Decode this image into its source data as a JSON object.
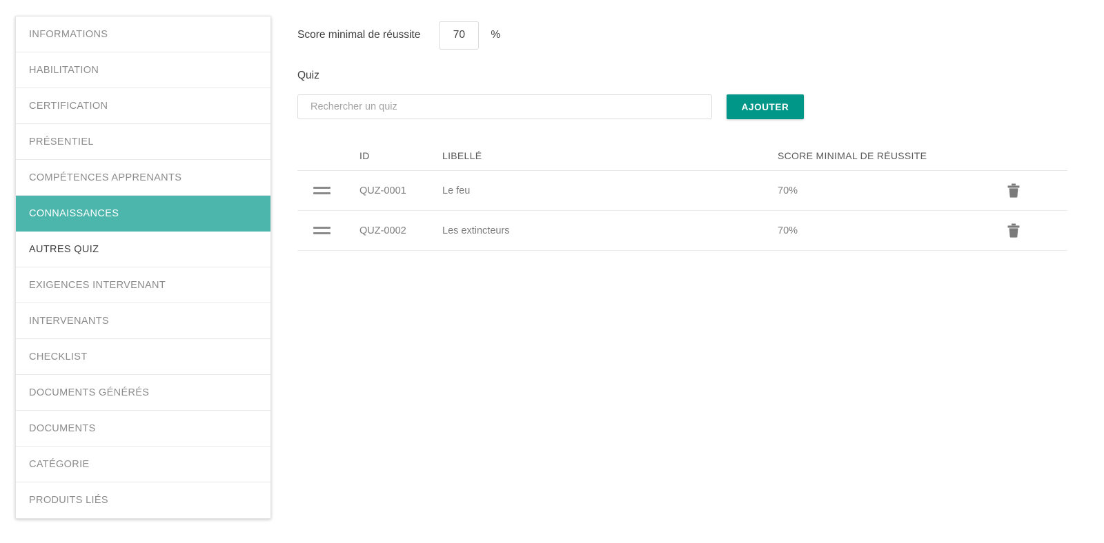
{
  "sidebar": {
    "items": [
      {
        "label": "INFORMATIONS",
        "state": "default"
      },
      {
        "label": "HABILITATION",
        "state": "default"
      },
      {
        "label": "CERTIFICATION",
        "state": "default"
      },
      {
        "label": "PRÉSENTIEL",
        "state": "default"
      },
      {
        "label": "COMPÉTENCES APPRENANTS",
        "state": "default"
      },
      {
        "label": "CONNAISSANCES",
        "state": "active"
      },
      {
        "label": "AUTRES QUIZ",
        "state": "sub"
      },
      {
        "label": "EXIGENCES INTERVENANT",
        "state": "default"
      },
      {
        "label": "INTERVENANTS",
        "state": "default"
      },
      {
        "label": "CHECKLIST",
        "state": "default"
      },
      {
        "label": "DOCUMENTS GÉNÉRÉS",
        "state": "default"
      },
      {
        "label": "DOCUMENTS",
        "state": "default"
      },
      {
        "label": "CATÉGORIE",
        "state": "default"
      },
      {
        "label": "PRODUITS LIÉS",
        "state": "default"
      }
    ]
  },
  "form": {
    "score_label": "Score minimal de réussite",
    "score_value": "70",
    "percent_symbol": "%",
    "quiz_label": "Quiz",
    "search_placeholder": "Rechercher un quiz",
    "search_value": "",
    "add_button_label": "AJOUTER"
  },
  "table": {
    "headers": {
      "id": "ID",
      "label": "LIBELLÉ",
      "score": "SCORE MINIMAL DE RÉUSSITE"
    },
    "rows": [
      {
        "id": "QUZ-0001",
        "label": "Le feu",
        "score": "70%"
      },
      {
        "id": "QUZ-0002",
        "label": "Les extincteurs",
        "score": "70%"
      }
    ]
  },
  "icons": {
    "drag_handle": "drag-handle-icon",
    "delete": "trash-icon"
  },
  "colors": {
    "sidebar_active": "#4db6ac",
    "button_primary": "#009688",
    "text_muted": "#8c8c8c",
    "text_dark": "#3d3d3d"
  }
}
